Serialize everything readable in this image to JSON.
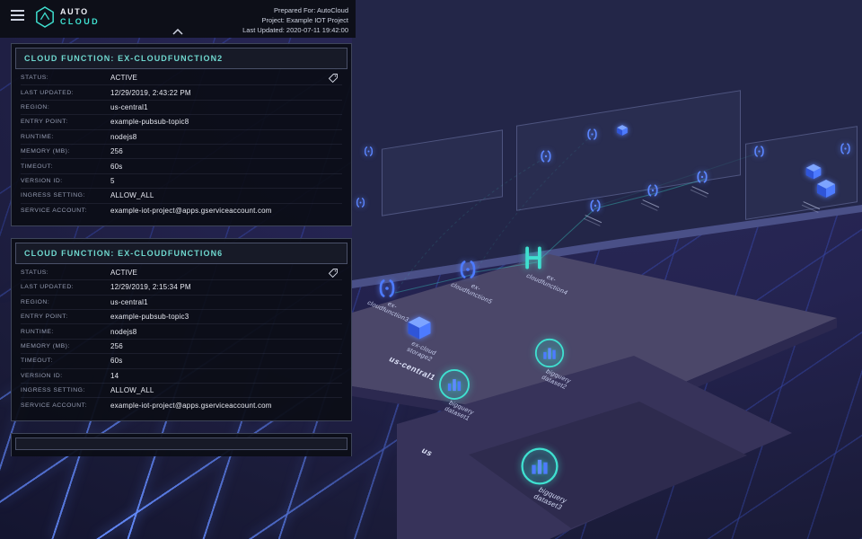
{
  "header": {
    "logo": {
      "line1": "AUTO",
      "line2": "CLOUD"
    },
    "meta": {
      "prepared_for": "Prepared For: AutoCloud",
      "project": "Project: Example IOT Project",
      "last_updated": "Last Updated: 2020-07-11 19:42:00"
    }
  },
  "panels": [
    {
      "title": "CLOUD FUNCTION: EX-CLOUDFUNCTION2",
      "rows": [
        {
          "label": "STATUS:",
          "value": "ACTIVE",
          "tag": true
        },
        {
          "label": "LAST UPDATED:",
          "value": "12/29/2019, 2:43:22 PM"
        },
        {
          "label": "REGION:",
          "value": "us-central1"
        },
        {
          "label": "ENTRY POINT:",
          "value": "example-pubsub-topic8"
        },
        {
          "label": "RUNTIME:",
          "value": "nodejs8"
        },
        {
          "label": "MEMORY (MB):",
          "value": "256"
        },
        {
          "label": "TIMEOUT:",
          "value": "60s"
        },
        {
          "label": "VERSION ID:",
          "value": "5"
        },
        {
          "label": "INGRESS SETTING:",
          "value": "ALLOW_ALL"
        },
        {
          "label": "SERVICE ACCOUNT:",
          "value": "example-iot-project@apps.gserviceaccount.com"
        }
      ]
    },
    {
      "title": "CLOUD FUNCTION: EX-CLOUDFUNCTION6",
      "rows": [
        {
          "label": "STATUS:",
          "value": "ACTIVE",
          "tag": true
        },
        {
          "label": "LAST UPDATED:",
          "value": "12/29/2019, 2:15:34 PM"
        },
        {
          "label": "REGION:",
          "value": "us-central1"
        },
        {
          "label": "ENTRY POINT:",
          "value": "example-pubsub-topic3"
        },
        {
          "label": "RUNTIME:",
          "value": "nodejs8"
        },
        {
          "label": "MEMORY (MB):",
          "value": "256"
        },
        {
          "label": "TIMEOUT:",
          "value": "60s"
        },
        {
          "label": "VERSION ID:",
          "value": "14"
        },
        {
          "label": "INGRESS SETTING:",
          "value": "ALLOW_ALL"
        },
        {
          "label": "SERVICE ACCOUNT:",
          "value": "example-iot-project@apps.gserviceaccount.com"
        }
      ]
    },
    {
      "title": "",
      "rows": []
    }
  ],
  "scene": {
    "region_labels": [
      {
        "text": "us-central1"
      },
      {
        "text": "us"
      }
    ],
    "resources": [
      {
        "type": "cloud-function",
        "label": "ex-cloudfunction3"
      },
      {
        "type": "cloud-function",
        "label": "ex-cloudfunction5"
      },
      {
        "type": "cloud-function",
        "label": "ex-cloudfunction4"
      },
      {
        "type": "cloud-storage",
        "label": "ex-cloud storage2"
      },
      {
        "type": "bigquery-dataset",
        "label": "bigquery dataset1"
      },
      {
        "type": "bigquery-dataset",
        "label": "bigquery dataset2"
      },
      {
        "type": "bigquery-dataset",
        "label": "bigquery dataset3"
      }
    ]
  },
  "colors": {
    "accent_teal": "#3FE0D0",
    "resource_blue": "#4D7BFF",
    "grid_blue": "#4466FF",
    "platform_purple": "#4B4769"
  },
  "icons": {
    "menu": "hamburger-icon",
    "collapse": "chevron-up-icon",
    "status": "tag-icon"
  }
}
